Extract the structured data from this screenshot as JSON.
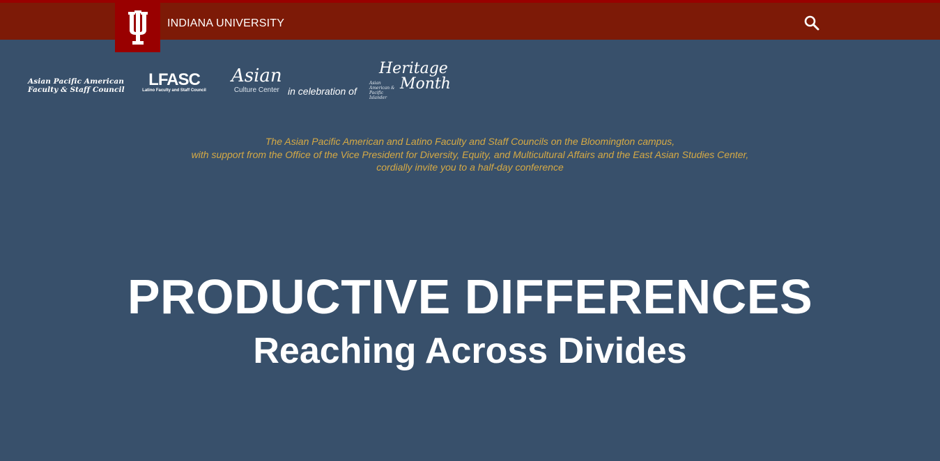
{
  "header": {
    "university_name": "INDIANA UNIVERSITY",
    "logo_icon": "iu-trident-icon",
    "search_icon": "search-icon",
    "colors": {
      "bar": "#7d1a07",
      "logo_bg": "#990000"
    }
  },
  "sponsors": {
    "apafsc_line1": "Asian Pacific American",
    "apafsc_line2": "Faculty & Staff Council",
    "lfasc_acronym": "LFASC",
    "lfasc_full": "Latino Faculty and Staff Council",
    "acc_script": "Asian",
    "acc_sub": "Culture Center",
    "celebration": "in celebration of",
    "heritage_word1": "Heritage",
    "heritage_word2": "Month",
    "heritage_tiny": "Asian American & Pacific Islander"
  },
  "invite": {
    "line1": "The Asian Pacific American and Latino Faculty and Staff Councils on the Bloomington campus,",
    "line2": "with support from the Office of the Vice President for Diversity, Equity, and Multicultural Affairs and the East Asian Studies Center,",
    "line3": "cordially invite you to a half-day conference",
    "color": "#d6aa45"
  },
  "hero": {
    "title": "PRODUCTIVE DIFFERENCES",
    "subtitle": "Reaching Across Divides"
  },
  "page": {
    "background": "#38506b"
  }
}
